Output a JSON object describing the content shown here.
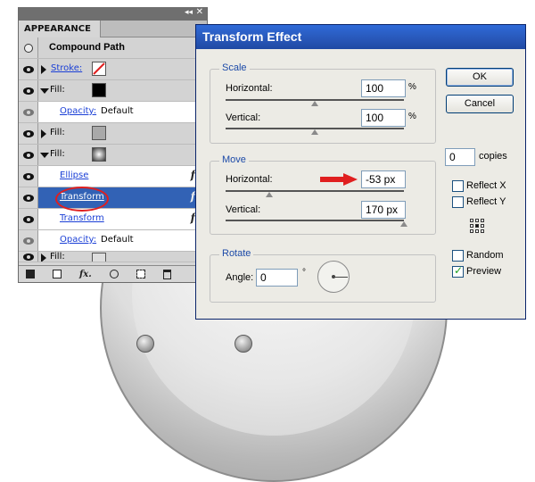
{
  "panel": {
    "tab_label": "APPEARANCE",
    "collapse_glyph": "◂◂",
    "menu_glyph": "✕",
    "header_title": "Compound Path",
    "rows": [
      {
        "label": "Stroke:",
        "kind": "stroke"
      },
      {
        "label": "Fill:",
        "kind": "fill-black"
      },
      {
        "label": "Opacity:",
        "value": "Default"
      },
      {
        "label": "Fill:",
        "kind": "fill-grey"
      },
      {
        "label": "Fill:",
        "kind": "fill-gradient"
      },
      {
        "label": "Ellipse",
        "fx": "fx"
      },
      {
        "label": "Transform",
        "fx": "fx"
      },
      {
        "label": "Transform",
        "fx": "fx"
      },
      {
        "label": "Opacity:",
        "value": "Default"
      },
      {
        "label": "Fill:",
        "kind": "fill-partial"
      }
    ],
    "bottom_fx": "fx."
  },
  "dialog": {
    "title": "Transform Effect",
    "scale": {
      "title": "Scale",
      "horizontal_label": "Horizontal:",
      "horizontal_value": "100",
      "horizontal_unit": "%",
      "vertical_label": "Vertical:",
      "vertical_value": "100",
      "vertical_unit": "%"
    },
    "move": {
      "title": "Move",
      "horizontal_label": "Horizontal:",
      "horizontal_value": "-53 px",
      "vertical_label": "Vertical:",
      "vertical_value": "170 px"
    },
    "rotate": {
      "title": "Rotate",
      "angle_label": "Angle:",
      "angle_value": "0",
      "angle_unit": "°"
    },
    "ok_label": "OK",
    "cancel_label": "Cancel",
    "copies_value": "0",
    "copies_label": "copies",
    "reflect_x_label": "Reflect X",
    "reflect_y_label": "Reflect Y",
    "random_label": "Random",
    "preview_label": "Preview",
    "reflect_x_checked": false,
    "reflect_y_checked": false,
    "random_checked": false,
    "preview_checked": true
  },
  "colors": {
    "titlebar": "#2857b8",
    "selected_row": "#3262b5",
    "annotation": "#e01f1f"
  }
}
